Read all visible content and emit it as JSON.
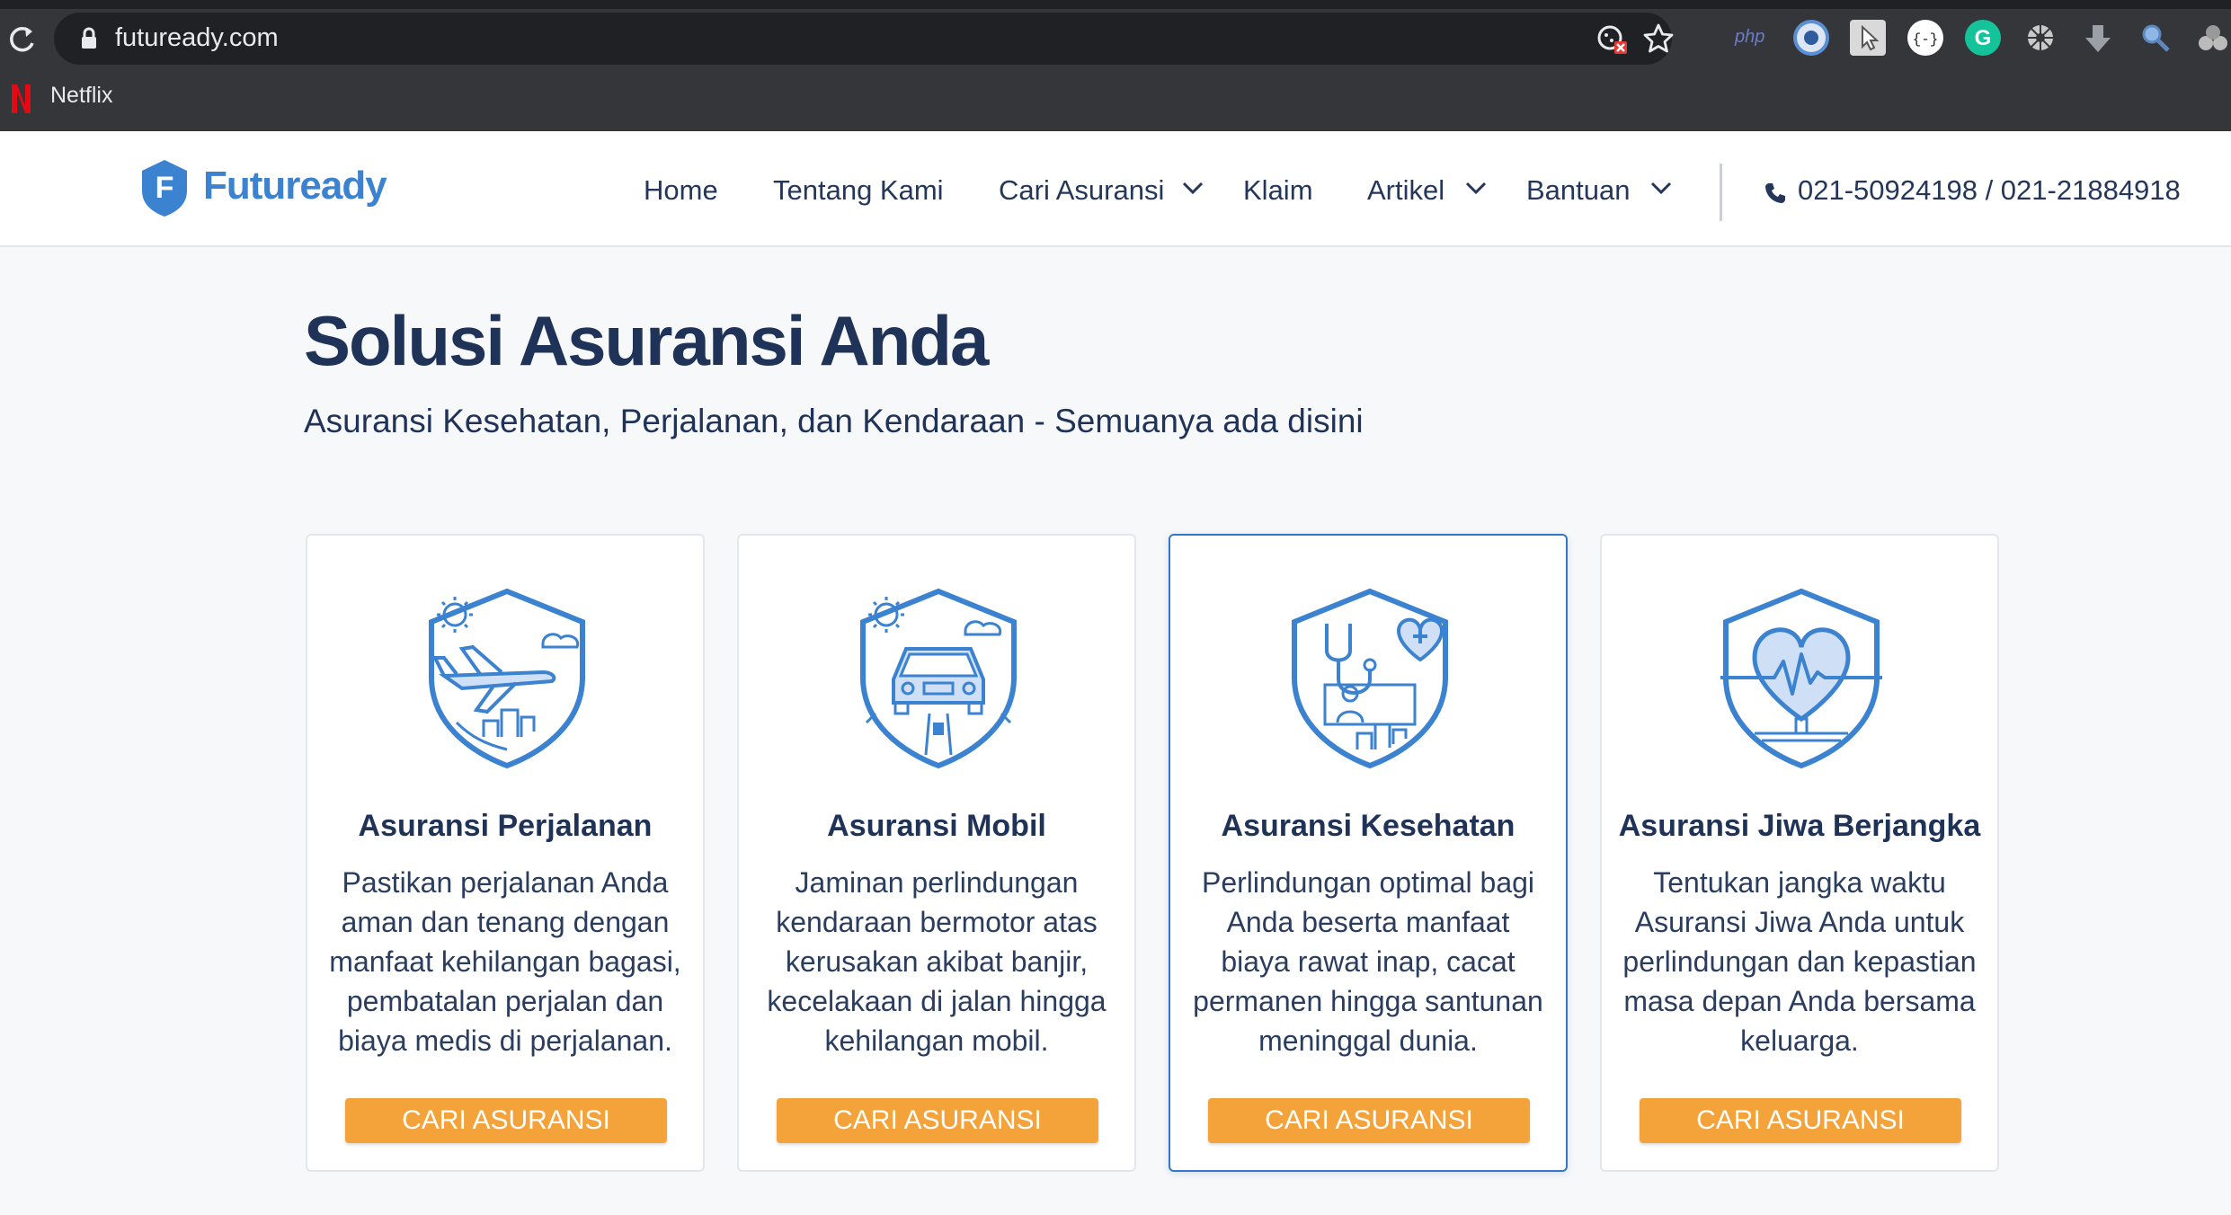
{
  "browser": {
    "url": "futuready.com",
    "bookmarks": [
      {
        "label": "Netflix",
        "icon": "netflix-icon"
      }
    ],
    "toolbar_icons": [
      "reload-icon",
      "lock-icon",
      "blocked-cookie-icon",
      "star-icon",
      "php-extension-icon",
      "circle-extension-icon",
      "cursor-extension-icon",
      "json-extension-icon",
      "grammarly-extension-icon",
      "gear-extension-icon",
      "download-icon",
      "search-extension-icon",
      "puzzle-extension-icon"
    ],
    "ext_label_php": "php"
  },
  "header": {
    "logo_letter": "F",
    "logo_text": "Futuready",
    "nav": [
      {
        "label": "Home"
      },
      {
        "label": "Tentang Kami"
      },
      {
        "label": "Cari Asuransi"
      },
      {
        "label": "Klaim"
      },
      {
        "label": "Artikel"
      },
      {
        "label": "Bantuan"
      }
    ],
    "phone": "021-50924198 / 021-21884918"
  },
  "hero": {
    "title": "Solusi Asuransi Anda",
    "subtitle": "Asuransi Kesehatan, Perjalanan, dan Kendaraan - Semuanya ada disini"
  },
  "cards": [
    {
      "title": "Asuransi Perjalanan",
      "icon": "travel-shield-icon",
      "desc": "Pastikan perjalanan Anda aman dan tenang dengan manfaat kehilangan bagasi, pembatalan perjalan dan biaya medis di perjalanan.",
      "button": "CARI ASURANSI"
    },
    {
      "title": "Asuransi Mobil",
      "icon": "car-shield-icon",
      "desc": "Jaminan perlindungan kendaraan bermotor atas kerusakan akibat banjir, kecelakaan di jalan hingga kehilangan mobil.",
      "button": "CARI ASURANSI"
    },
    {
      "title": "Asuransi Kesehatan",
      "icon": "health-shield-icon",
      "desc": "Perlindungan optimal bagi Anda beserta manfaat biaya rawat inap, cacat permanen hingga santunan meninggal dunia.",
      "button": "CARI ASURANSI"
    },
    {
      "title": "Asuransi Jiwa Berjangka",
      "icon": "life-shield-icon",
      "desc": "Tentukan jangka waktu Asuransi Jiwa Anda untuk perlindungan dan kepastian masa depan Anda bersama keluarga.",
      "button": "CARI ASURANSI"
    }
  ],
  "colors": {
    "brand": "#3b82d0",
    "navy": "#1f3258",
    "button": "#f4a23a",
    "active_border": "#3476c8"
  }
}
